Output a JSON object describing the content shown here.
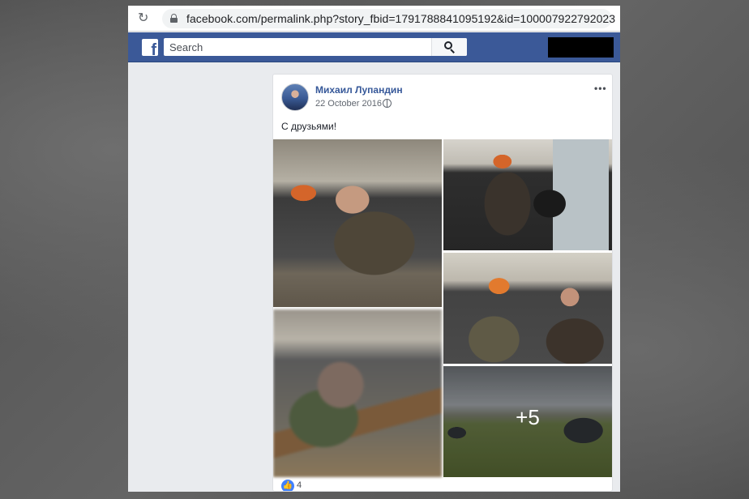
{
  "browser": {
    "url": "facebook.com/permalink.php?story_fbid=1791788841095192&id=100007922792023"
  },
  "topbar": {
    "logo_letter": "f",
    "search_placeholder": "Search",
    "brand_color": "#3b5998"
  },
  "post": {
    "author": "Михаил Лупандин",
    "date": "22 October 2016",
    "text": "С друзьями!",
    "more_photos": "+5",
    "like_count": "4"
  },
  "icons": [
    "reload-icon",
    "lock-icon",
    "facebook-logo",
    "search-icon",
    "globe-icon",
    "more-options-icon",
    "like-icon"
  ]
}
